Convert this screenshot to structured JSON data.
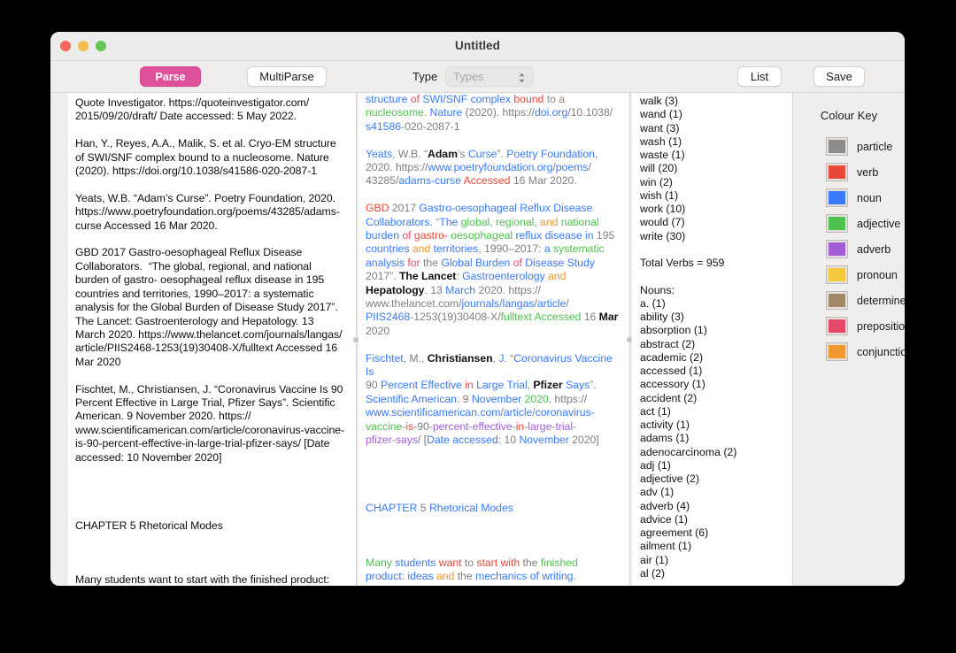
{
  "window": {
    "title": "Untitled",
    "traffic_lights": [
      "close",
      "minimize",
      "zoom"
    ]
  },
  "toolbar": {
    "parse_label": "Parse",
    "multiparse_label": "MultiParse",
    "type_label": "Type",
    "type_select_value": "",
    "type_select_placeholder": "Types",
    "list_label": "List",
    "save_label": "Save"
  },
  "source_text": "Quote Investigator. https://quoteinvestigator.com/\n2015/09/20/draft/ Date accessed: 5 May 2022.\n\nHan, Y., Reyes, A.A., Malik, S. et al. Cryo-EM structure\nof SWI/SNF complex bound to a nucleosome. Nature\n(2020). https://doi.org/10.1038/s41586-020-2087-1\n\nYeats, W.B. “Adam’s Curse”. Poetry Foundation, 2020.\nhttps://www.poetryfoundation.org/poems/43285/adams-\ncurse Accessed 16 Mar 2020.\n\nGBD 2017 Gastro-oesophageal Reflux Disease\nCollaborators.  “The global, regional, and national\nburden of gastro- oesophageal reflux disease in 195\ncountries and territories, 1990–2017: a systematic\nanalysis for the Global Burden of Disease Study 2017”.\nThe Lancet: Gastroenterology and Hepatology. 13\nMarch 2020. https://www.thelancet.com/journals/langas/\narticle/PIIS2468-1253(19)30408-X/fulltext Accessed 16\nMar 2020\n\nFischtet, M., Christiansen, J. “Coronavirus Vaccine Is 90\nPercent Effective in Large Trial, Pfizer Says”. Scientific\nAmerican. 9 November 2020. https://\nwww.scientificamerican.com/article/coronavirus-vaccine-\nis-90-percent-effective-in-large-trial-pfizer-says/ [Date\naccessed: 10 November 2020]\n\n\n\n\nCHAPTER 5 Rhetorical Modes\n\n\n\nMany students want to start with the finished product:\nideas and the mechanics of writing.",
  "colours": {
    "particle": "#8c8c8c",
    "verb": "#e9483a",
    "noun": "#3a7afe",
    "adjective": "#4fc14f",
    "adverb": "#a35ed6",
    "pronoun": "#f5c93c",
    "determiner": "#a08867",
    "preposition": "#e6486a",
    "conjunction": "#f0982e",
    "plain": "#7f7f7f",
    "black": "#111111"
  },
  "parsed_lines": [
    [
      [
        "structure",
        "noun"
      ],
      [
        " ",
        ""
      ],
      [
        "of",
        "preposition"
      ],
      [
        " ",
        ""
      ],
      [
        "SWI/SNF",
        "noun"
      ],
      [
        " ",
        ""
      ],
      [
        "complex",
        "noun"
      ],
      [
        " ",
        ""
      ],
      [
        "bound",
        "verb"
      ],
      [
        " ",
        ""
      ],
      [
        "to",
        "particle"
      ],
      [
        " ",
        ""
      ],
      [
        "a",
        "determiner"
      ]
    ],
    [
      [
        "nucleosome",
        "adjective"
      ],
      [
        ". ",
        "plain"
      ],
      [
        "Nature",
        "noun"
      ],
      [
        " (2020). https://",
        "plain"
      ],
      [
        "doi.org",
        "noun"
      ],
      [
        "/10.1038/",
        "plain"
      ]
    ],
    [
      [
        "s41586",
        "noun"
      ],
      [
        "-020-2087-1",
        "plain"
      ]
    ],
    [],
    [
      [
        "Yeats",
        "noun"
      ],
      [
        ", W.B. “",
        "plain"
      ],
      [
        "Adam",
        "black"
      ],
      [
        "’s ",
        "plain"
      ],
      [
        "Curse",
        "noun"
      ],
      [
        "”. ",
        "plain"
      ],
      [
        "Poetry",
        "noun"
      ],
      [
        " ",
        "plain"
      ],
      [
        "Foundation",
        "noun"
      ],
      [
        ",",
        "plain"
      ]
    ],
    [
      [
        "2020. https://",
        "plain"
      ],
      [
        "www.poetryfoundation.org",
        "noun"
      ],
      [
        "/",
        "plain"
      ],
      [
        "poems",
        "noun"
      ],
      [
        "/",
        "plain"
      ]
    ],
    [
      [
        "43285",
        "plain"
      ],
      [
        "/",
        "plain"
      ],
      [
        "adams-curse",
        "noun"
      ],
      [
        " ",
        "plain"
      ],
      [
        "Accessed",
        "verb"
      ],
      [
        " 16 Mar 2020.",
        "plain"
      ]
    ],
    [],
    [
      [
        "GBD",
        "verb"
      ],
      [
        " 2017 ",
        "plain"
      ],
      [
        "Gastro-oesophageal",
        "noun"
      ],
      [
        " ",
        "plain"
      ],
      [
        "Reflux",
        "noun"
      ],
      [
        " ",
        "plain"
      ],
      [
        "Disease",
        "noun"
      ]
    ],
    [
      [
        "Collaborators",
        "noun"
      ],
      [
        ".  “",
        "plain"
      ],
      [
        "The",
        "noun"
      ],
      [
        " ",
        "plain"
      ],
      [
        "global",
        "adjective"
      ],
      [
        ", ",
        "plain"
      ],
      [
        "regional",
        "adjective"
      ],
      [
        ", ",
        "plain"
      ],
      [
        "and",
        "conjunction"
      ],
      [
        " ",
        "plain"
      ],
      [
        "national",
        "adjective"
      ]
    ],
    [
      [
        "burden",
        "noun"
      ],
      [
        " ",
        "plain"
      ],
      [
        "of",
        "preposition"
      ],
      [
        " ",
        "plain"
      ],
      [
        "gastro-",
        "verb"
      ],
      [
        " ",
        "plain"
      ],
      [
        "oesophageal",
        "adjective"
      ],
      [
        " ",
        "plain"
      ],
      [
        "reflux",
        "noun"
      ],
      [
        " ",
        "plain"
      ],
      [
        "disease",
        "noun"
      ],
      [
        " ",
        "plain"
      ],
      [
        "in",
        "noun"
      ],
      [
        " 195",
        "plain"
      ]
    ],
    [
      [
        "countries",
        "noun"
      ],
      [
        " ",
        "plain"
      ],
      [
        "and",
        "conjunction"
      ],
      [
        " ",
        "plain"
      ],
      [
        "territories",
        "noun"
      ],
      [
        ", 1990–2017: ",
        "plain"
      ],
      [
        "a",
        "noun"
      ],
      [
        " ",
        "plain"
      ],
      [
        "systematic",
        "adjective"
      ]
    ],
    [
      [
        "analysis",
        "noun"
      ],
      [
        " ",
        "plain"
      ],
      [
        "for",
        "preposition"
      ],
      [
        " ",
        "plain"
      ],
      [
        "the",
        "plain"
      ],
      [
        " ",
        "plain"
      ],
      [
        "Global",
        "noun"
      ],
      [
        " ",
        "plain"
      ],
      [
        "Burden",
        "noun"
      ],
      [
        " ",
        "plain"
      ],
      [
        "of",
        "preposition"
      ],
      [
        " ",
        "plain"
      ],
      [
        "Disease",
        "noun"
      ],
      [
        " ",
        "plain"
      ],
      [
        "Study",
        "noun"
      ]
    ],
    [
      [
        "2017”. ",
        "plain"
      ],
      [
        "The Lancet",
        "black"
      ],
      [
        ": ",
        "plain"
      ],
      [
        "Gastroenterology",
        "noun"
      ],
      [
        " ",
        "plain"
      ],
      [
        "and",
        "conjunction"
      ]
    ],
    [
      [
        "Hepatology",
        "black"
      ],
      [
        ". 13 ",
        "plain"
      ],
      [
        "March",
        "noun"
      ],
      [
        " 2020. https://",
        "plain"
      ]
    ],
    [
      [
        "www.thelancet.com",
        "plain"
      ],
      [
        "/",
        "plain"
      ],
      [
        "journals",
        "noun"
      ],
      [
        "/",
        "plain"
      ],
      [
        "langas",
        "noun"
      ],
      [
        "/",
        "plain"
      ],
      [
        "article",
        "noun"
      ],
      [
        "/",
        "plain"
      ]
    ],
    [
      [
        "PIIS2468",
        "noun"
      ],
      [
        "-1253(19)30408-X/",
        "plain"
      ],
      [
        "fulltext",
        "adjective"
      ],
      [
        " ",
        "plain"
      ],
      [
        "Accessed",
        "adjective"
      ],
      [
        " 16 ",
        "plain"
      ],
      [
        "Mar",
        "black"
      ]
    ],
    [
      [
        "2020",
        "plain"
      ]
    ],
    [],
    [
      [
        "Fischtet",
        "noun"
      ],
      [
        ", M.",
        "plain"
      ],
      [
        ", ",
        "plain"
      ],
      [
        "Christiansen",
        "black"
      ],
      [
        ", ",
        "plain"
      ],
      [
        "J",
        "noun"
      ],
      [
        ". “",
        "plain"
      ],
      [
        "Coronavirus",
        "noun"
      ],
      [
        " ",
        "plain"
      ],
      [
        "Vaccine",
        "noun"
      ],
      [
        " ",
        "plain"
      ],
      [
        "Is",
        "noun"
      ]
    ],
    [
      [
        "90 ",
        "plain"
      ],
      [
        "Percent",
        "noun"
      ],
      [
        " ",
        "plain"
      ],
      [
        "Effective",
        "noun"
      ],
      [
        " ",
        "plain"
      ],
      [
        "in",
        "verb"
      ],
      [
        " ",
        "plain"
      ],
      [
        "Large",
        "noun"
      ],
      [
        " ",
        "plain"
      ],
      [
        "Trial",
        "noun"
      ],
      [
        ", ",
        "plain"
      ],
      [
        "Pfizer",
        "black"
      ],
      [
        " ",
        "plain"
      ],
      [
        "Says",
        "noun"
      ],
      [
        "”.",
        "plain"
      ]
    ],
    [
      [
        "Scientific American",
        "noun"
      ],
      [
        ". 9 ",
        "plain"
      ],
      [
        "November",
        "noun"
      ],
      [
        " ",
        "plain"
      ],
      [
        "2020",
        "adjective"
      ],
      [
        ". https://",
        "plain"
      ]
    ],
    [
      [
        "www.scientificamerican.com",
        "noun"
      ],
      [
        "/",
        "plain"
      ],
      [
        "article",
        "noun"
      ],
      [
        "/",
        "plain"
      ],
      [
        "coronavirus-",
        "noun"
      ]
    ],
    [
      [
        "vaccine",
        "adjective"
      ],
      [
        "-",
        "plain"
      ],
      [
        "is",
        "verb"
      ],
      [
        "-90-",
        "plain"
      ],
      [
        "percent",
        "adverb"
      ],
      [
        "-",
        "plain"
      ],
      [
        "effective",
        "adverb"
      ],
      [
        "-",
        "plain"
      ],
      [
        "in",
        "verb"
      ],
      [
        "-",
        "plain"
      ],
      [
        "large",
        "adverb"
      ],
      [
        "-",
        "plain"
      ],
      [
        "trial",
        "adverb"
      ],
      [
        "-",
        "plain"
      ]
    ],
    [
      [
        "pfizer",
        "adverb"
      ],
      [
        "-",
        "plain"
      ],
      [
        "says",
        "adverb"
      ],
      [
        "/ [",
        "plain"
      ],
      [
        "Date",
        "noun"
      ],
      [
        " ",
        "plain"
      ],
      [
        "accessed",
        "noun"
      ],
      [
        ": 10 ",
        "plain"
      ],
      [
        "November",
        "noun"
      ],
      [
        " 2020]",
        "plain"
      ]
    ],
    [],
    [],
    [],
    [],
    [
      [
        "CHAPTER",
        "noun"
      ],
      [
        " 5 ",
        "plain"
      ],
      [
        "Rhetorical",
        "noun"
      ],
      [
        " ",
        "plain"
      ],
      [
        "Modes",
        "noun"
      ]
    ],
    [],
    [],
    [],
    [
      [
        "Many",
        "adjective"
      ],
      [
        " ",
        "plain"
      ],
      [
        "students",
        "noun"
      ],
      [
        " ",
        "plain"
      ],
      [
        "want",
        "verb"
      ],
      [
        " ",
        "plain"
      ],
      [
        "to",
        "plain"
      ],
      [
        " ",
        "plain"
      ],
      [
        "start",
        "verb"
      ],
      [
        " ",
        "plain"
      ],
      [
        "with",
        "verb"
      ],
      [
        " ",
        "plain"
      ],
      [
        "the",
        "plain"
      ],
      [
        " ",
        "plain"
      ],
      [
        "finished",
        "adjective"
      ]
    ],
    [
      [
        "product",
        "noun"
      ],
      [
        ": ",
        "plain"
      ],
      [
        "ideas",
        "noun"
      ],
      [
        " ",
        "plain"
      ],
      [
        "and",
        "conjunction"
      ],
      [
        " ",
        "plain"
      ],
      [
        "the",
        "plain"
      ],
      [
        " ",
        "plain"
      ],
      [
        "mechanics",
        "noun"
      ],
      [
        " ",
        "plain"
      ],
      [
        "of",
        "noun"
      ],
      [
        " ",
        "plain"
      ],
      [
        "writing",
        "noun"
      ],
      [
        ".",
        "plain"
      ]
    ]
  ],
  "word_list": [
    "walk (3)",
    "wand (1)",
    "want (3)",
    "wash (1)",
    "waste (1)",
    "will (20)",
    "win (2)",
    "wish (1)",
    "work (10)",
    "would (7)",
    "write (30)",
    "",
    "Total Verbs = 959",
    "",
    "Nouns:",
    "a. (1)",
    "ability (3)",
    "absorption (1)",
    "abstract (2)",
    "academic (2)",
    "accessed (1)",
    "accessory (1)",
    "accident (2)",
    "act (1)",
    "activity (1)",
    "adams (1)",
    "adenocarcinoma (2)",
    "adj (1)",
    "adjective (2)",
    "adv (1)",
    "adverb (4)",
    "advice (1)",
    "agreement (6)",
    "ailment (1)",
    "air (1)",
    "al (2)"
  ],
  "colour_key": {
    "title": "Colour Key",
    "items": [
      {
        "label": "particle",
        "colour": "#8c8c8c"
      },
      {
        "label": "verb",
        "colour": "#e9483a"
      },
      {
        "label": "noun",
        "colour": "#3a7afe"
      },
      {
        "label": "adjective",
        "colour": "#4fc14f"
      },
      {
        "label": "adverb",
        "colour": "#a35ed6"
      },
      {
        "label": "pronoun",
        "colour": "#f5c93c"
      },
      {
        "label": "determiner",
        "colour": "#a08867"
      },
      {
        "label": "preposition",
        "colour": "#e6486a"
      },
      {
        "label": "conjunction",
        "colour": "#f0982e"
      }
    ]
  }
}
